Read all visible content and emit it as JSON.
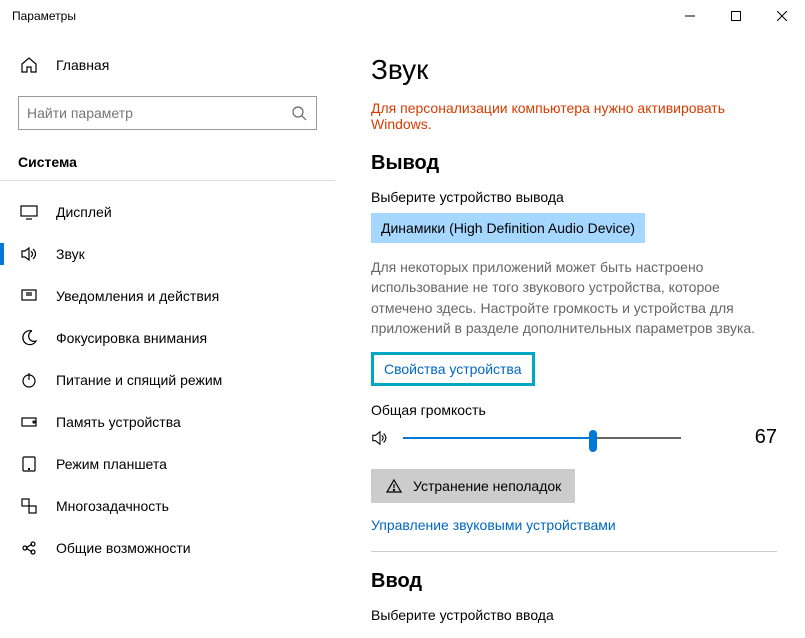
{
  "window": {
    "title": "Параметры"
  },
  "sidebar": {
    "home": "Главная",
    "search_placeholder": "Найти параметр",
    "section": "Система",
    "items": [
      {
        "label": "Дисплей"
      },
      {
        "label": "Звук"
      },
      {
        "label": "Уведомления и действия"
      },
      {
        "label": "Фокусировка внимания"
      },
      {
        "label": "Питание и спящий режим"
      },
      {
        "label": "Память устройства"
      },
      {
        "label": "Режим планшета"
      },
      {
        "label": "Многозадачность"
      },
      {
        "label": "Общие возможности"
      }
    ]
  },
  "main": {
    "title": "Звук",
    "activation_notice": "Для персонализации компьютера нужно активировать Windows.",
    "output_header": "Вывод",
    "output_device_label": "Выберите устройство вывода",
    "output_device_value": "Динамики (High Definition Audio Device)",
    "output_help": "Для некоторых приложений может быть настроено использование не того звукового устройства, которое отмечено здесь. Настройте громкость и устройства для приложений в разделе дополнительных параметров звука.",
    "device_props": "Свойства устройства",
    "master_volume_label": "Общая громкость",
    "master_volume_value": "67",
    "troubleshoot": "Устранение неполадок",
    "manage_devices": "Управление звуковыми устройствами",
    "input_header": "Ввод",
    "input_device_label": "Выберите устройство ввода"
  }
}
